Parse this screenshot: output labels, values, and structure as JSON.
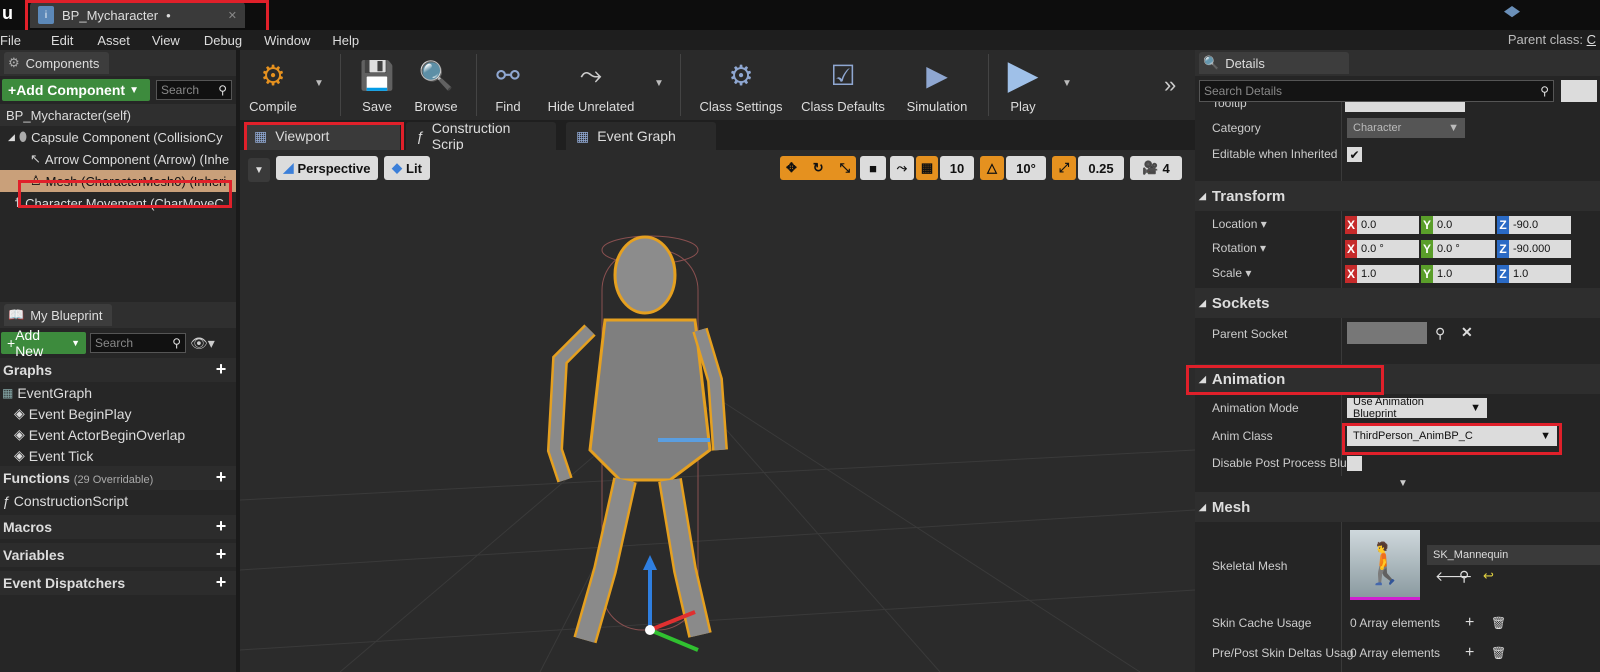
{
  "window": {
    "tab_title": "BP_Mycharacter",
    "parent_class_label": "Parent class:",
    "parent_class_value": "C"
  },
  "menu": [
    "File",
    "Edit",
    "Asset",
    "View",
    "Debug",
    "Window",
    "Help"
  ],
  "components": {
    "title": "Components",
    "add_label": "Add Component",
    "search_placeholder": "Search",
    "items": [
      {
        "label": "BP_Mycharacter(self)",
        "icon": "self-icon"
      },
      {
        "label": "Capsule Component (CollisionCy",
        "icon": "capsule-icon"
      },
      {
        "label": "Arrow Component (Arrow) (Inhe",
        "icon": "arrow-icon"
      },
      {
        "label": "Mesh (CharacterMesh0) (Inheri",
        "icon": "mesh-icon"
      },
      {
        "label": "Character Movement (CharMoveC",
        "icon": "movement-icon"
      }
    ]
  },
  "my_blueprint": {
    "title": "My Blueprint",
    "add_label": "Add New",
    "search_placeholder": "Search",
    "graphs_label": "Graphs",
    "event_graph": "EventGraph",
    "events": [
      "Event BeginPlay",
      "Event ActorBeginOverlap",
      "Event Tick"
    ],
    "functions_label": "Functions",
    "functions_count": "(29 Overridable)",
    "construction_script": "ConstructionScript",
    "macros_label": "Macros",
    "variables_label": "Variables",
    "dispatchers_label": "Event Dispatchers"
  },
  "toolbar": {
    "compile": "Compile",
    "save": "Save",
    "browse": "Browse",
    "find": "Find",
    "hide_unrelated": "Hide Unrelated",
    "class_settings": "Class Settings",
    "class_defaults": "Class Defaults",
    "simulation": "Simulation",
    "play": "Play"
  },
  "editor_tabs": {
    "viewport": "Viewport",
    "construction": "Construction Scrip",
    "event_graph": "Event Graph"
  },
  "viewport": {
    "perspective": "Perspective",
    "lit": "Lit",
    "grid_snap": "10",
    "rot_snap": "10°",
    "scale_snap": "0.25",
    "cam_speed": "4"
  },
  "details": {
    "title": "Details",
    "search_placeholder": "Search Details",
    "tooltip_label": "Tooltip",
    "category_label": "Category",
    "category_value": "Character",
    "editable_label": "Editable when Inherited",
    "transform": {
      "title": "Transform",
      "location_label": "Location",
      "rotation_label": "Rotation",
      "scale_label": "Scale",
      "location": [
        "0.0",
        "0.0",
        "-90.0"
      ],
      "rotation": [
        "0.0 °",
        "0.0 °",
        "-90.000"
      ],
      "scale": [
        "1.0",
        "1.0",
        "1.0"
      ]
    },
    "sockets": {
      "title": "Sockets",
      "parent_socket_label": "Parent Socket"
    },
    "animation": {
      "title": "Animation",
      "mode_label": "Animation Mode",
      "mode_value": "Use Animation Blueprint",
      "class_label": "Anim Class",
      "class_value": "ThirdPerson_AnimBP_C",
      "disable_label": "Disable Post Process Blue"
    },
    "mesh": {
      "title": "Mesh",
      "skeletal_label": "Skeletal Mesh",
      "skeletal_value": "SK_Mannequin",
      "skin_cache_label": "Skin Cache Usage",
      "skin_cache_value": "0 Array elements",
      "prepost_label": "Pre/Post Skin Deltas Usag",
      "prepost_value": "0 Array elements"
    }
  },
  "colors": {
    "accent_orange": "#e5911f",
    "highlight_red": "#e0202a",
    "add_green": "#3d8b3d",
    "selected_row": "#c9a07a"
  }
}
